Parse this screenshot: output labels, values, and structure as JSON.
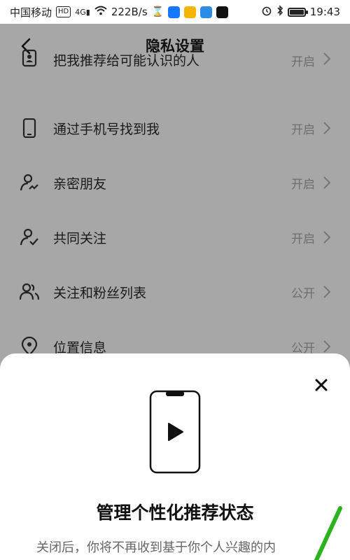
{
  "status_bar": {
    "carrier": "中国移动",
    "hd_badge": "HD",
    "network": "4G",
    "speed": "222B/s",
    "time": "19:43",
    "battery_level": 0.9,
    "icons": [
      "hd-icon",
      "signal-icon",
      "wifi-icon",
      "hourglass-icon",
      "app-blue-icon",
      "app-yellow-icon",
      "app-cloud-icon",
      "app-capcut-icon",
      "alarm-icon",
      "bluetooth-icon",
      "battery-icon"
    ]
  },
  "header": {
    "title": "隐私设置"
  },
  "settings": [
    {
      "label": "把我推荐给可能认识的人",
      "value": "开启",
      "icon": "contact-card-icon"
    },
    {
      "label": "通过手机号找到我",
      "value": "开启",
      "icon": "phone-icon"
    },
    {
      "label": "亲密朋友",
      "value": "开启",
      "icon": "close-friend-icon"
    },
    {
      "label": "共同关注",
      "value": "开启",
      "icon": "mutual-follow-icon"
    },
    {
      "label": "关注和粉丝列表",
      "value": "公开",
      "icon": "followers-icon"
    },
    {
      "label": "位置信息",
      "value": "公开",
      "icon": "location-icon"
    }
  ],
  "sheet": {
    "title": "管理个性化推荐状态",
    "description": "关闭后，你将不再收到基于你个人兴趣的内"
  },
  "colors": {
    "overlay": "#a7a7a7",
    "sheet_bg": "#ffffff",
    "accent_green": "#2ab31f"
  }
}
